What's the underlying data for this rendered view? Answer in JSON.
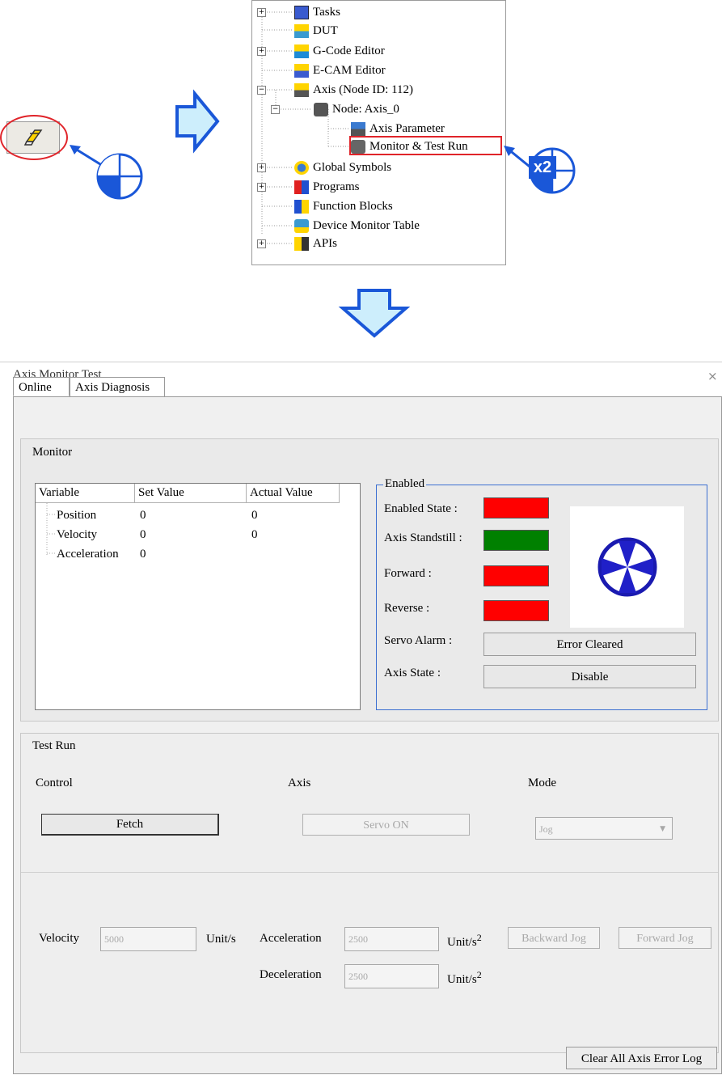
{
  "tree": {
    "items": [
      {
        "label": "Tasks"
      },
      {
        "label": "DUT"
      },
      {
        "label": "G-Code Editor"
      },
      {
        "label": "E-CAM Editor"
      },
      {
        "label": "Axis (Node ID: 112)"
      },
      {
        "label": "Node: Axis_0"
      },
      {
        "label": "Axis Parameter"
      },
      {
        "label": "Monitor & Test Run"
      },
      {
        "label": "Global Symbols"
      },
      {
        "label": "Programs"
      },
      {
        "label": "Function Blocks"
      },
      {
        "label": "Device Monitor Table"
      },
      {
        "label": "APIs"
      }
    ],
    "double_click_badge": "x2"
  },
  "dialog": {
    "title": "Axis Monitor Test",
    "close_glyph": "×",
    "tabs": [
      {
        "label": "Online"
      },
      {
        "label": "Axis Diagnosis"
      }
    ],
    "monitor": {
      "title": "Monitor",
      "columns": [
        "Variable",
        "Set Value",
        "Actual Value"
      ],
      "rows": [
        {
          "variable": "Position",
          "set": "0",
          "actual": "0"
        },
        {
          "variable": "Velocity",
          "set": "0",
          "actual": "0"
        },
        {
          "variable": "Acceleration",
          "set": "0",
          "actual": ""
        }
      ]
    },
    "enabled": {
      "title": "Enabled",
      "enabled_state": {
        "label": "Enabled State :",
        "color": "#ff0000"
      },
      "axis_standstill": {
        "label": "Axis Standstill :",
        "color": "#008000"
      },
      "forward": {
        "label": "Forward :",
        "color": "#ff0000"
      },
      "reverse": {
        "label": "Reverse :",
        "color": "#ff0000"
      },
      "servo_alarm": {
        "label": "Servo Alarm :",
        "value": "Error Cleared"
      },
      "axis_state": {
        "label": "Axis State :",
        "value": "Disable"
      }
    },
    "test_run": {
      "title": "Test Run",
      "control_label": "Control",
      "axis_label": "Axis",
      "mode_label": "Mode",
      "fetch_button": "Fetch",
      "servo_button": "Servo ON",
      "mode_value": "Jog",
      "velocity_label": "Velocity",
      "velocity_value": "5000",
      "velocity_unit": "Unit/s",
      "acceleration_label": "Acceleration",
      "acceleration_value": "2500",
      "acceleration_unit": "Unit/s",
      "acceleration_unit_sup": "2",
      "deceleration_label": "Deceleration",
      "deceleration_value": "2500",
      "deceleration_unit": "Unit/s",
      "deceleration_unit_sup": "2",
      "backward_jog": "Backward Jog",
      "forward_jog": "Forward Jog"
    },
    "clear_log_button": "Clear All Axis Error Log"
  },
  "colors": {
    "accent_blue": "#1a57d8",
    "arrow_fill": "#cdeefc",
    "highlight_red": "#e0242a",
    "status_red": "#ff0000",
    "status_green": "#008000"
  }
}
